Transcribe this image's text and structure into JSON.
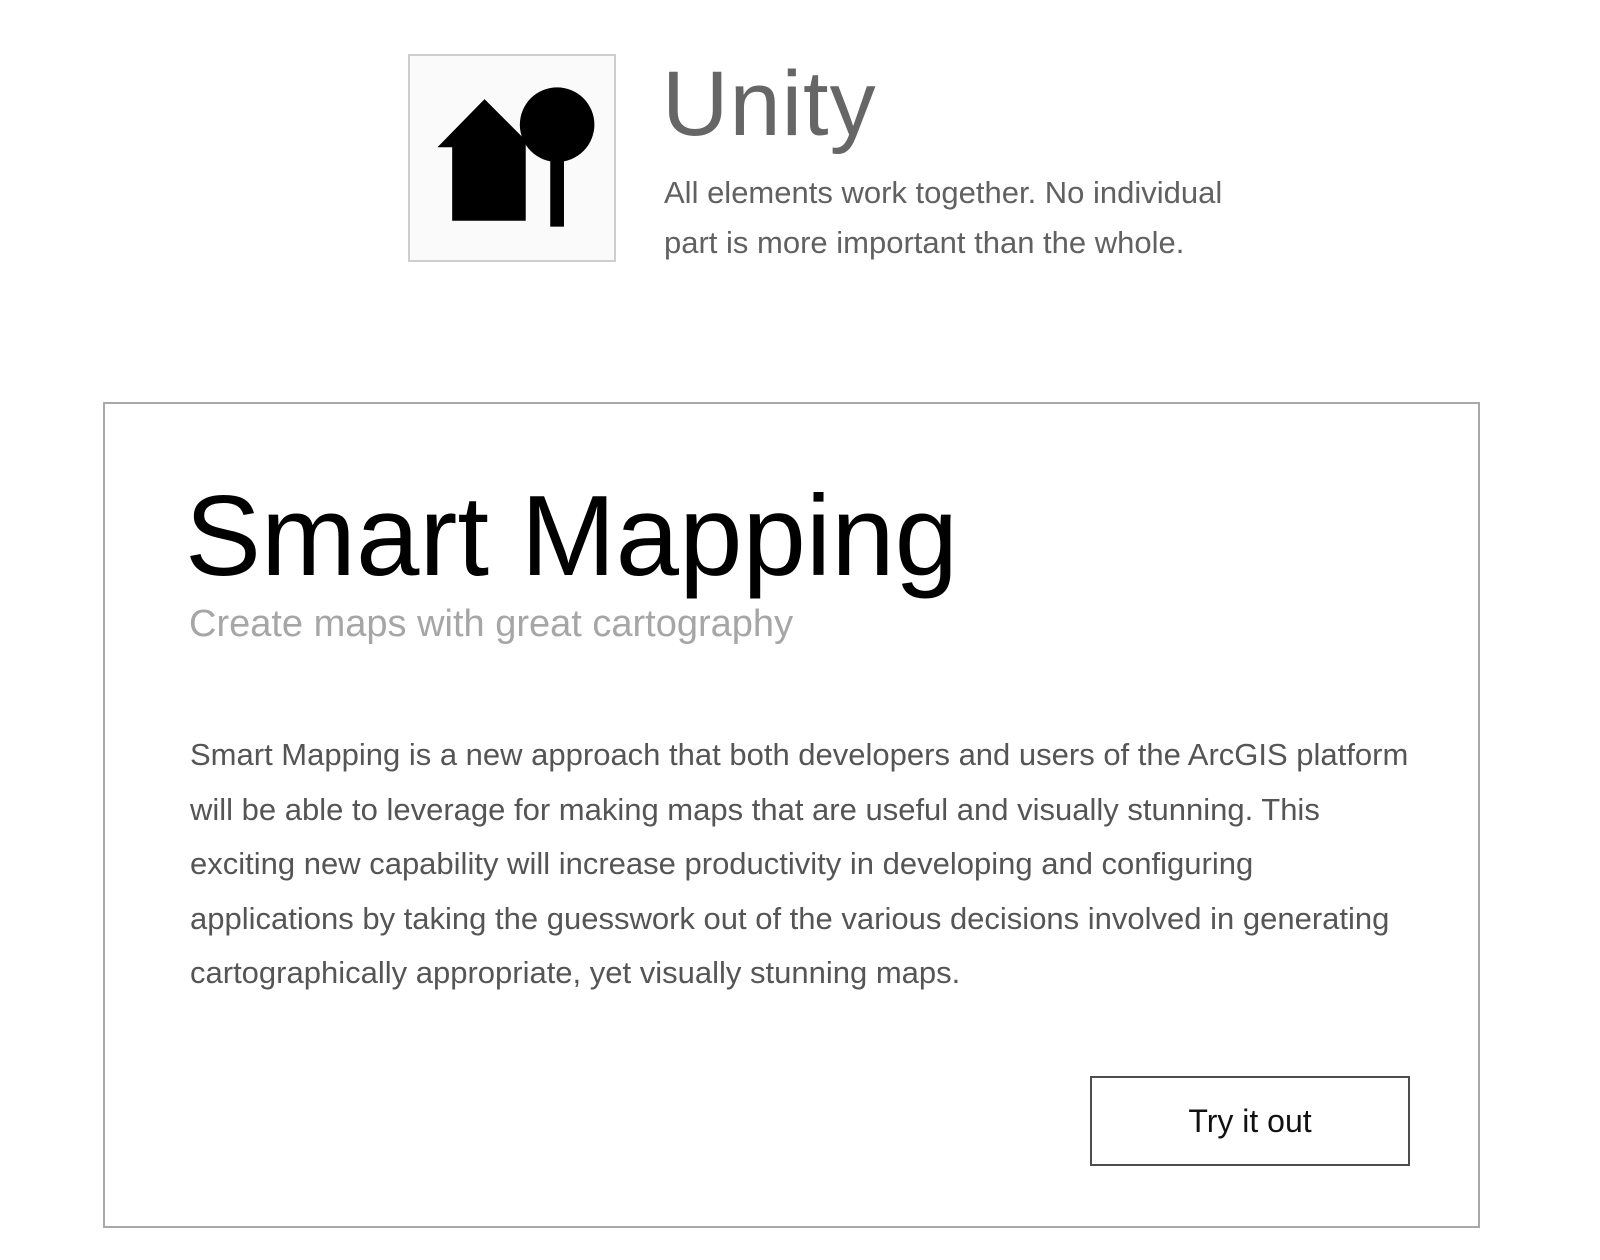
{
  "principle": {
    "icon": "house-and-tree-icon",
    "title": "Unity",
    "description": "All elements work together. No individual part is more important than the whole."
  },
  "card": {
    "title": "Smart Mapping",
    "subtitle": "Create maps with great cartography",
    "body": "Smart Mapping is a new approach that both developers and users of the ArcGIS platform will be able to leverage for making maps that are useful and visually stunning. This exciting new capability will increase productivity in developing and configuring applications by taking the guesswork out of the various decisions involved in generating cartographically appropriate, yet visually stunning maps.",
    "button_label": "Try it out"
  },
  "colors": {
    "card_border": "#a9a9a9",
    "icon_border": "#cfcfcf",
    "subtitle": "#a6a6a6",
    "body_text": "#555555"
  }
}
